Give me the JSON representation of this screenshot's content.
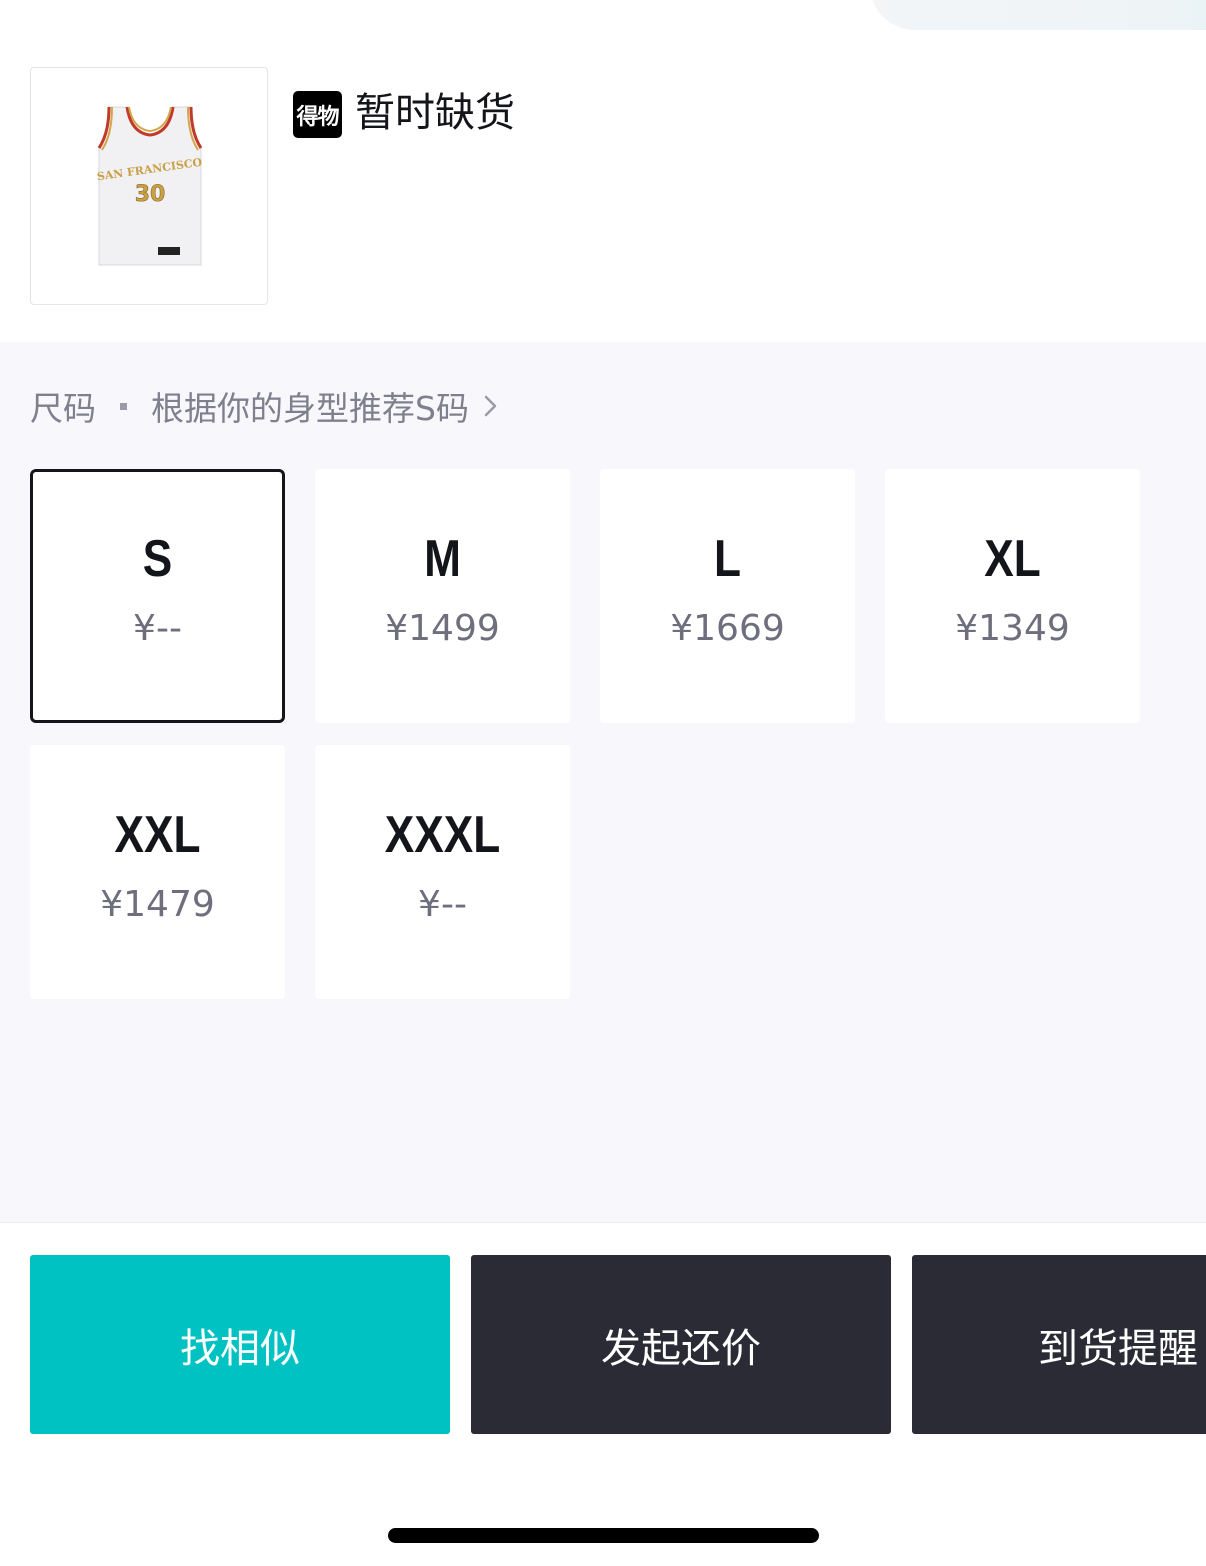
{
  "product": {
    "brand_badge": "得物",
    "stock_status": "暂时缺货",
    "jersey_text": "SAN FRANCISCO",
    "jersey_number": "30"
  },
  "size_section": {
    "label": "尺码",
    "recommendation": "根据你的身型推荐S码"
  },
  "sizes": [
    {
      "size": "S",
      "price": "¥--",
      "selected": true
    },
    {
      "size": "M",
      "price": "¥1499",
      "selected": false
    },
    {
      "size": "L",
      "price": "¥1669",
      "selected": false
    },
    {
      "size": "XL",
      "price": "¥1349",
      "selected": false
    },
    {
      "size": "XXL",
      "price": "¥1479",
      "selected": false
    },
    {
      "size": "XXXL",
      "price": "¥--",
      "selected": false
    }
  ],
  "actions": {
    "find_similar": "找相似",
    "make_offer": "发起还价",
    "notify_arrival": "到货提醒"
  },
  "colors": {
    "accent": "#01c2c3",
    "dark_button": "#2b2b35",
    "panel_bg": "#f8f8fc"
  }
}
